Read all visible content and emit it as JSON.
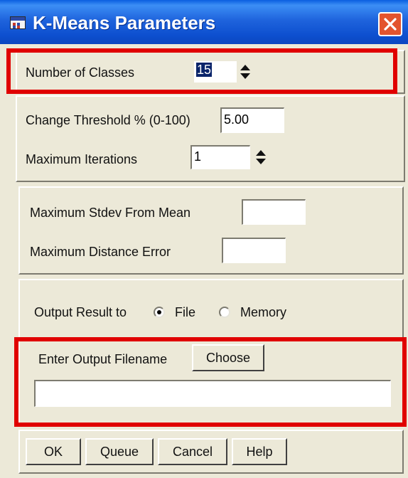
{
  "window": {
    "title": "K-Means Parameters"
  },
  "classes": {
    "label": "Number of Classes",
    "value": "15"
  },
  "change": {
    "threshold_label": "Change Threshold % (0-100)",
    "threshold_value": "5.00",
    "iterations_label": "Maximum Iterations",
    "iterations_value": "1"
  },
  "limits": {
    "stdev_label": "Maximum Stdev From Mean",
    "stdev_value": "",
    "distance_label": "Maximum Distance Error",
    "distance_value": ""
  },
  "output": {
    "label": "Output Result to",
    "options": [
      {
        "label": "File",
        "selected": true
      },
      {
        "label": "Memory",
        "selected": false
      }
    ],
    "filename_label": "Enter Output Filename",
    "choose_label": "Choose",
    "filename_value": ""
  },
  "buttons": {
    "ok": "OK",
    "queue": "Queue",
    "cancel": "Cancel",
    "help": "Help"
  },
  "colors": {
    "title_bar": "#0b52d8",
    "dialog_bg": "#ece9d8",
    "highlight": "#e00000",
    "close_button": "#e3542e"
  },
  "icons": [
    "app-icon",
    "close-icon",
    "spinner-arrows-icon",
    "radio-icon"
  ]
}
